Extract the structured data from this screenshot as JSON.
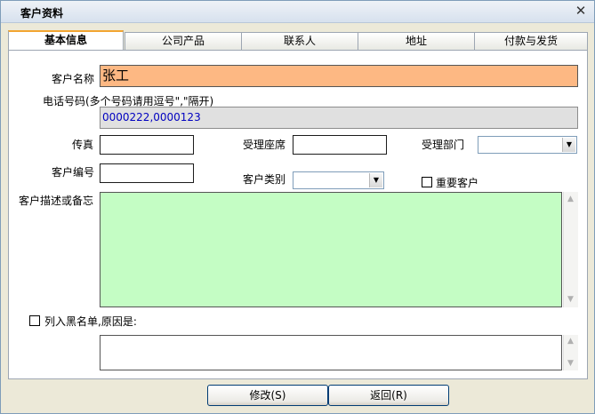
{
  "window": {
    "title": "客户资料",
    "close_glyph": "✕"
  },
  "tabs": [
    {
      "label": "基本信息",
      "active": true
    },
    {
      "label": "公司产品",
      "active": false
    },
    {
      "label": "联系人",
      "active": false
    },
    {
      "label": "地址",
      "active": false
    },
    {
      "label": "付款与发货",
      "active": false
    }
  ],
  "form": {
    "customer_name_label": "客户名称",
    "customer_name_value": "张工",
    "phone_label": "电话号码(多个号码请用逗号\",\"隔开)",
    "phone_value": "0000222,0000123",
    "fax_label": "传真",
    "fax_value": "",
    "agent_seat_label": "受理座席",
    "agent_seat_value": "",
    "dept_label": "受理部门",
    "dept_value": "",
    "customer_no_label": "客户编号",
    "customer_no_value": "",
    "customer_type_label": "客户类别",
    "customer_type_value": "",
    "important_label": "重要客户",
    "important_checked": false,
    "memo_label": "客户描述或备忘",
    "memo_value": "",
    "blacklist_label": "列入黑名单,原因是:",
    "blacklist_checked": false,
    "blacklist_reason": ""
  },
  "buttons": {
    "modify": "修改(S)",
    "back": "返回(R)"
  },
  "colors": {
    "name_bg": "#fdb883",
    "memo_bg": "#c4fdc4",
    "phone_text": "#0000c0",
    "tab_accent": "#f2a531"
  }
}
